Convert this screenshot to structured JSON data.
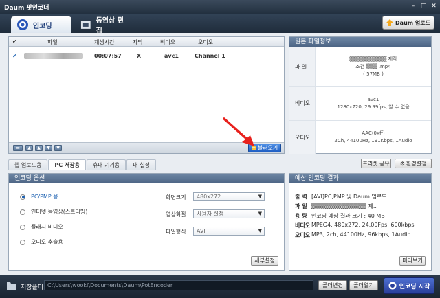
{
  "window": {
    "title": "Daum 팟인코더"
  },
  "main_tabs": [
    {
      "label": "인코딩"
    },
    {
      "label": "동영상 편집"
    }
  ],
  "header": {
    "daum_upload": "Daum 업로드"
  },
  "filelist": {
    "columns": [
      "파일",
      "재생시간",
      "자막",
      "비디오",
      "오디오"
    ],
    "rows": [
      {
        "file": "▒▒▒▒▒▒▒▒▒▒▒▒",
        "duration": "00:07:57",
        "subtitle": "X",
        "video": "avc1",
        "audio": "Channel 1"
      }
    ],
    "load_button": "불러오기"
  },
  "original_info": {
    "title": "원본 파일정보",
    "file_label": "파 일",
    "file_line1": "▒▒▒▒▒▒▒▒▒▒ 제작",
    "file_line2": "조건 ▒▒▒ .mp4",
    "file_line3": "( 57MB )",
    "video_label": "비디오",
    "video_line1": "avc1",
    "video_line2": "1280x720, 29.99fps, 알 수 없음",
    "audio_label": "오디오",
    "audio_line1": "AAC(0xff)",
    "audio_line2": "2Ch, 44100Hz, 191Kbps, 1Audio"
  },
  "sub_tabs": [
    "웹 업로드용",
    "PC 저장용",
    "휴대 기기용",
    "내 설정"
  ],
  "share_button": "프리셋 공유",
  "settings_button": "환경설정",
  "encoding_options": {
    "title": "인코딩 옵션",
    "radios": [
      "PC/PMP 용",
      "인터넷 동영상(스트리밍)",
      "플래시 비디오",
      "오디오 추출용"
    ],
    "screen_size_label": "화면크기",
    "screen_size_value": "480x272",
    "quality_label": "영상화질",
    "quality_value": "사용자 설정",
    "format_label": "파일형식",
    "format_value": "AVI",
    "detail_button": "세부설정"
  },
  "result": {
    "title": "예상 인코딩 결과",
    "rows": [
      {
        "label": "출력",
        "value": "[AVI]PC,PMP 및 Daum 업로드"
      },
      {
        "label": "파일",
        "value": "▒▒▒▒▒▒▒▒▒▒▒▒▒ 제.."
      },
      {
        "label": "용량",
        "value": "인코딩 예상 결과 크기 : 40 MB"
      },
      {
        "label": "비디오",
        "value": "MPEG4, 480x272, 24.00Fps, 600kbps"
      },
      {
        "label": "오디오",
        "value": "MP3, 2ch, 44100Hz, 96kbps, 1Audio"
      }
    ],
    "preview_button": "미리보기"
  },
  "bottom": {
    "folder_label": "저장폴더",
    "path": "C:\\Users\\wooki\\Documents\\Daum\\PotEncoder",
    "change_button": "폴더변경",
    "open_button": "폴더열기",
    "start_button": "인코딩 시작"
  },
  "colors": {
    "accent": "#1a5fb0",
    "panel_header": "#5a7393",
    "bottom_bar": "#1a2532"
  }
}
